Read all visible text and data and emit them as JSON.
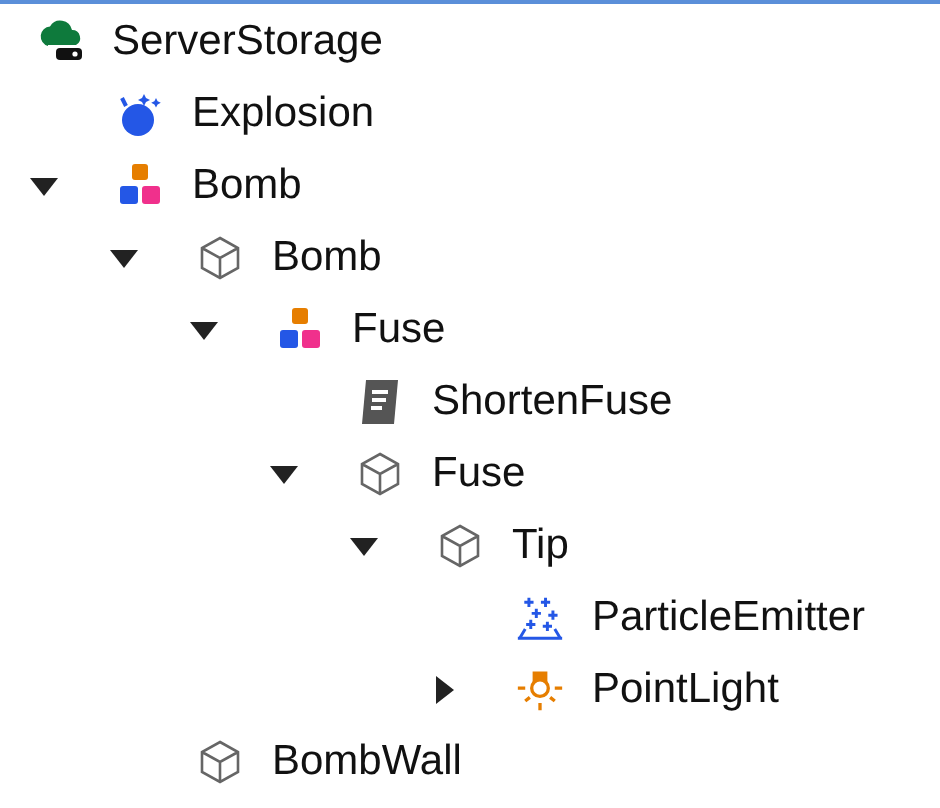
{
  "tree": [
    {
      "label": "ServerStorage",
      "kind": "storage",
      "children": [
        {
          "label": "Explosion",
          "kind": "effect"
        },
        {
          "label": "Bomb",
          "kind": "model",
          "expanded": true,
          "children": [
            {
              "label": "Bomb",
              "kind": "part",
              "expanded": true,
              "children": [
                {
                  "label": "Fuse",
                  "kind": "model",
                  "expanded": true,
                  "children": [
                    {
                      "label": "ShortenFuse",
                      "kind": "script"
                    },
                    {
                      "label": "Fuse",
                      "kind": "part",
                      "expanded": true,
                      "children": [
                        {
                          "label": "Tip",
                          "kind": "part",
                          "expanded": true,
                          "children": [
                            {
                              "label": "ParticleEmitter",
                              "kind": "particles"
                            },
                            {
                              "label": "PointLight",
                              "kind": "light",
                              "expanded": false
                            }
                          ]
                        }
                      ]
                    }
                  ]
                }
              ]
            },
            {
              "label": "BombWall",
              "kind": "part"
            }
          ]
        }
      ]
    }
  ]
}
